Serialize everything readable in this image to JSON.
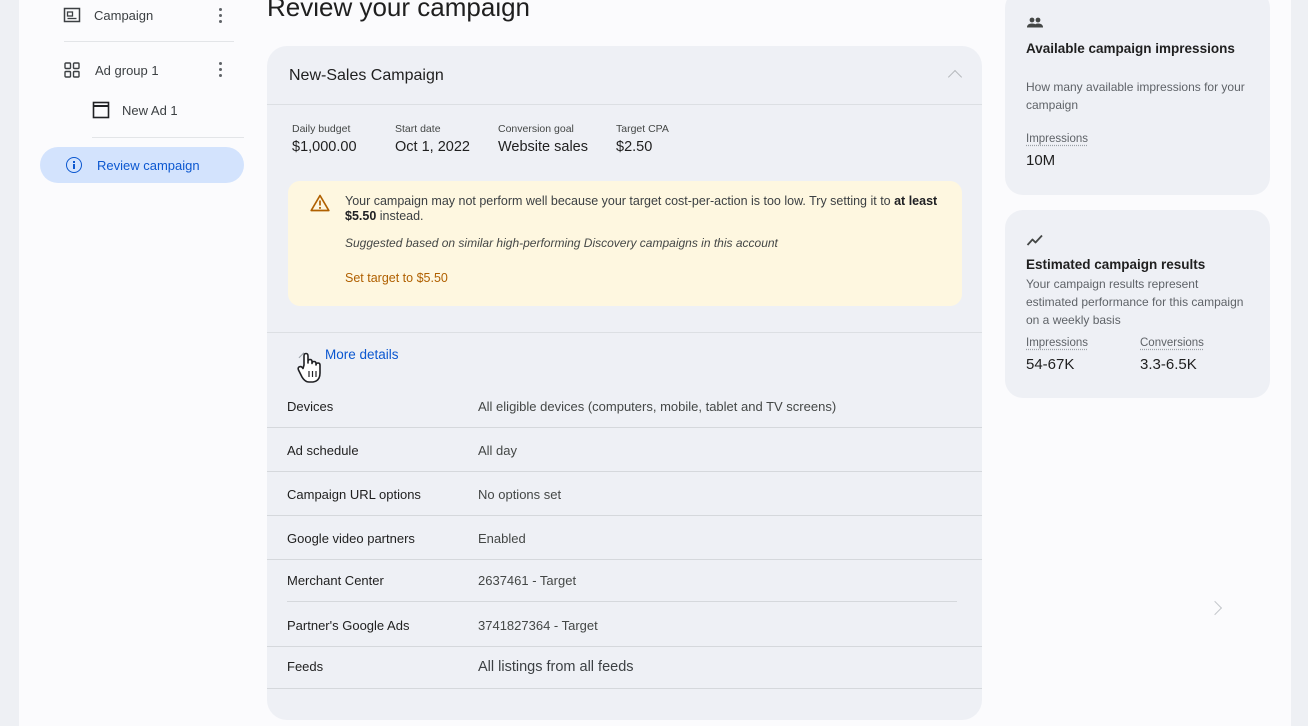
{
  "sidebar": {
    "campaign_label": "Campaign",
    "adgroup_label": "Ad group 1",
    "ad_label": "New Ad 1",
    "review_label": "Review campaign"
  },
  "page": {
    "title": "Review your campaign"
  },
  "campaign_card": {
    "name": "New-Sales Campaign",
    "stats": [
      {
        "label": "Daily budget",
        "value": "$1,000.00"
      },
      {
        "label": "Start date",
        "value": "Oct 1, 2022"
      },
      {
        "label": "Conversion goal",
        "value": "Website sales"
      },
      {
        "label": "Target CPA",
        "value": "$2.50"
      }
    ],
    "warning": {
      "message_part1": "Your campaign may not perform well because your target cost-per-action is too low. Try setting it to ",
      "message_bold": "at least $5.50",
      "message_part2": " instead.",
      "suggestion": "Suggested based on similar high-performing Discovery campaigns in this account",
      "action_label": "Set target to $5.50"
    },
    "more_details_label": "More details",
    "details": [
      {
        "key": "Devices",
        "value": "All eligible devices (computers, mobile, tablet and TV screens)"
      },
      {
        "key": "Ad schedule",
        "value": "All day"
      },
      {
        "key": "Campaign URL options",
        "value": "No options set"
      },
      {
        "key": "Google video partners",
        "value": "Enabled"
      },
      {
        "key": "Merchant Center",
        "value": "2637461 - Target"
      },
      {
        "key": "Partner's Google Ads",
        "value": "3741827364 - Target"
      },
      {
        "key": "Feeds",
        "value": "All listings from all feeds"
      }
    ]
  },
  "impressions_card": {
    "title": "Available campaign impressions",
    "description": "How many available impressions for your campaign",
    "metric_label": "Impressions",
    "metric_value": "10M"
  },
  "results_card": {
    "title": "Estimated campaign results",
    "description": "Your campaign results represent estimated performance for this campaign on a weekly basis",
    "impressions_label": "Impressions",
    "impressions_value": "54-67K",
    "conversions_label": "Conversions",
    "conversions_value": "3.3-6.5K"
  },
  "colors": {
    "accent": "#0b57d0",
    "review_pill": "#d3e3fd",
    "warning_bg": "#fef7e0",
    "warning_icon": "#b06000"
  },
  "icons": [
    "campaign-icon",
    "ad-group-icon",
    "ad-icon",
    "info-icon",
    "warning-icon",
    "people-icon",
    "trending-icon",
    "hand-cursor-icon",
    "chevron-up-icon",
    "chevron-right-icon",
    "more-vert-icon"
  ]
}
